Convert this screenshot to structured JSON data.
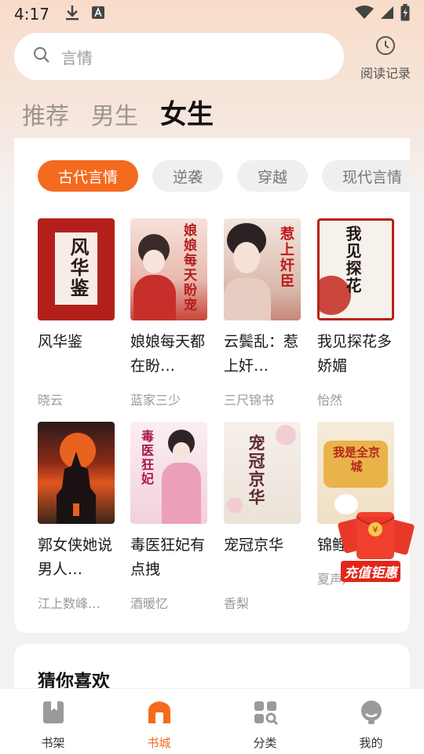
{
  "status": {
    "time": "4:17"
  },
  "search": {
    "placeholder": "言情"
  },
  "history": {
    "label": "阅读记录"
  },
  "top_tabs": [
    {
      "label": "推荐",
      "active": false
    },
    {
      "label": "男生",
      "active": false
    },
    {
      "label": "女生",
      "active": true
    }
  ],
  "categories": [
    {
      "label": "古代言情",
      "active": true
    },
    {
      "label": "逆袭",
      "active": false
    },
    {
      "label": "穿越",
      "active": false
    },
    {
      "label": "现代言情",
      "active": false
    }
  ],
  "books": [
    {
      "title": "风华鉴",
      "author": "晓云",
      "cover_text": "风华鉴",
      "cover_color": "#b3201c"
    },
    {
      "title": "娘娘每天都在盼…",
      "author": "蓝家三少",
      "cover_text": "娘娘每天盼宠",
      "cover_color": "#f2d6cf"
    },
    {
      "title": "云鬓乱：惹上奸…",
      "author": "三尺锦书",
      "cover_text": "惹上奸臣",
      "cover_color": "#e9d7cc"
    },
    {
      "title": "我见探花多娇媚",
      "author": "怡然",
      "cover_text": "我见探花",
      "cover_color": "#f7f1ec"
    },
    {
      "title": "郭女侠她说男人…",
      "author": "江上数峰…",
      "cover_text": "",
      "cover_color": "#3a2020"
    },
    {
      "title": "毒医狂妃有点拽",
      "author": "酒暖忆",
      "cover_text": "毒医狂妃",
      "cover_color": "#f6e4ea"
    },
    {
      "title": "宠冠京华",
      "author": "香梨",
      "cover_text": "宠冠京华",
      "cover_color": "#f1ece6"
    },
    {
      "title": "锦鲤三岁",
      "author": "夏声声",
      "cover_text": "我是全京城",
      "cover_color": "#f3e9d8"
    }
  ],
  "section2": {
    "title": "猜你喜欢"
  },
  "promo": {
    "label": "充值钜惠"
  },
  "nav": [
    {
      "label": "书架",
      "icon": "bookshelf-icon",
      "active": false
    },
    {
      "label": "书城",
      "icon": "bookstore-icon",
      "active": true
    },
    {
      "label": "分类",
      "icon": "category-icon",
      "active": false
    },
    {
      "label": "我的",
      "icon": "profile-icon",
      "active": false
    }
  ],
  "colors": {
    "accent": "#f46a1e",
    "promo_red": "#e2261a"
  }
}
